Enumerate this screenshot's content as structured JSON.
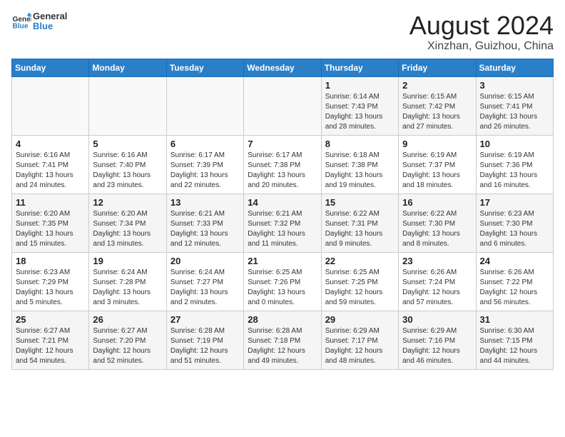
{
  "header": {
    "logo_line1": "General",
    "logo_line2": "Blue",
    "title": "August 2024",
    "subtitle": "Xinzhan, Guizhou, China"
  },
  "weekdays": [
    "Sunday",
    "Monday",
    "Tuesday",
    "Wednesday",
    "Thursday",
    "Friday",
    "Saturday"
  ],
  "weeks": [
    [
      {
        "day": "",
        "info": ""
      },
      {
        "day": "",
        "info": ""
      },
      {
        "day": "",
        "info": ""
      },
      {
        "day": "",
        "info": ""
      },
      {
        "day": "1",
        "info": "Sunrise: 6:14 AM\nSunset: 7:43 PM\nDaylight: 13 hours and 28 minutes."
      },
      {
        "day": "2",
        "info": "Sunrise: 6:15 AM\nSunset: 7:42 PM\nDaylight: 13 hours and 27 minutes."
      },
      {
        "day": "3",
        "info": "Sunrise: 6:15 AM\nSunset: 7:41 PM\nDaylight: 13 hours and 26 minutes."
      }
    ],
    [
      {
        "day": "4",
        "info": "Sunrise: 6:16 AM\nSunset: 7:41 PM\nDaylight: 13 hours and 24 minutes."
      },
      {
        "day": "5",
        "info": "Sunrise: 6:16 AM\nSunset: 7:40 PM\nDaylight: 13 hours and 23 minutes."
      },
      {
        "day": "6",
        "info": "Sunrise: 6:17 AM\nSunset: 7:39 PM\nDaylight: 13 hours and 22 minutes."
      },
      {
        "day": "7",
        "info": "Sunrise: 6:17 AM\nSunset: 7:38 PM\nDaylight: 13 hours and 20 minutes."
      },
      {
        "day": "8",
        "info": "Sunrise: 6:18 AM\nSunset: 7:38 PM\nDaylight: 13 hours and 19 minutes."
      },
      {
        "day": "9",
        "info": "Sunrise: 6:19 AM\nSunset: 7:37 PM\nDaylight: 13 hours and 18 minutes."
      },
      {
        "day": "10",
        "info": "Sunrise: 6:19 AM\nSunset: 7:36 PM\nDaylight: 13 hours and 16 minutes."
      }
    ],
    [
      {
        "day": "11",
        "info": "Sunrise: 6:20 AM\nSunset: 7:35 PM\nDaylight: 13 hours and 15 minutes."
      },
      {
        "day": "12",
        "info": "Sunrise: 6:20 AM\nSunset: 7:34 PM\nDaylight: 13 hours and 13 minutes."
      },
      {
        "day": "13",
        "info": "Sunrise: 6:21 AM\nSunset: 7:33 PM\nDaylight: 13 hours and 12 minutes."
      },
      {
        "day": "14",
        "info": "Sunrise: 6:21 AM\nSunset: 7:32 PM\nDaylight: 13 hours and 11 minutes."
      },
      {
        "day": "15",
        "info": "Sunrise: 6:22 AM\nSunset: 7:31 PM\nDaylight: 13 hours and 9 minutes."
      },
      {
        "day": "16",
        "info": "Sunrise: 6:22 AM\nSunset: 7:30 PM\nDaylight: 13 hours and 8 minutes."
      },
      {
        "day": "17",
        "info": "Sunrise: 6:23 AM\nSunset: 7:30 PM\nDaylight: 13 hours and 6 minutes."
      }
    ],
    [
      {
        "day": "18",
        "info": "Sunrise: 6:23 AM\nSunset: 7:29 PM\nDaylight: 13 hours and 5 minutes."
      },
      {
        "day": "19",
        "info": "Sunrise: 6:24 AM\nSunset: 7:28 PM\nDaylight: 13 hours and 3 minutes."
      },
      {
        "day": "20",
        "info": "Sunrise: 6:24 AM\nSunset: 7:27 PM\nDaylight: 13 hours and 2 minutes."
      },
      {
        "day": "21",
        "info": "Sunrise: 6:25 AM\nSunset: 7:26 PM\nDaylight: 13 hours and 0 minutes."
      },
      {
        "day": "22",
        "info": "Sunrise: 6:25 AM\nSunset: 7:25 PM\nDaylight: 12 hours and 59 minutes."
      },
      {
        "day": "23",
        "info": "Sunrise: 6:26 AM\nSunset: 7:24 PM\nDaylight: 12 hours and 57 minutes."
      },
      {
        "day": "24",
        "info": "Sunrise: 6:26 AM\nSunset: 7:22 PM\nDaylight: 12 hours and 56 minutes."
      }
    ],
    [
      {
        "day": "25",
        "info": "Sunrise: 6:27 AM\nSunset: 7:21 PM\nDaylight: 12 hours and 54 minutes."
      },
      {
        "day": "26",
        "info": "Sunrise: 6:27 AM\nSunset: 7:20 PM\nDaylight: 12 hours and 52 minutes."
      },
      {
        "day": "27",
        "info": "Sunrise: 6:28 AM\nSunset: 7:19 PM\nDaylight: 12 hours and 51 minutes."
      },
      {
        "day": "28",
        "info": "Sunrise: 6:28 AM\nSunset: 7:18 PM\nDaylight: 12 hours and 49 minutes."
      },
      {
        "day": "29",
        "info": "Sunrise: 6:29 AM\nSunset: 7:17 PM\nDaylight: 12 hours and 48 minutes."
      },
      {
        "day": "30",
        "info": "Sunrise: 6:29 AM\nSunset: 7:16 PM\nDaylight: 12 hours and 46 minutes."
      },
      {
        "day": "31",
        "info": "Sunrise: 6:30 AM\nSunset: 7:15 PM\nDaylight: 12 hours and 44 minutes."
      }
    ]
  ]
}
